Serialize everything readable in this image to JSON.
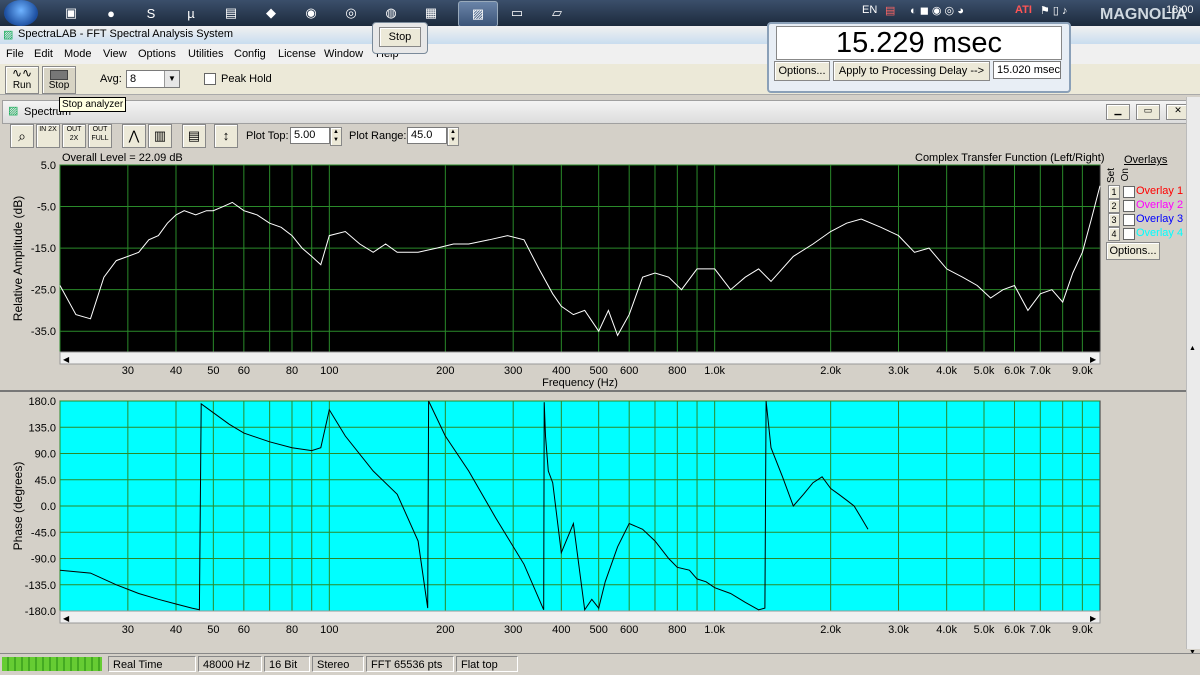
{
  "taskbar": {
    "lang": "EN",
    "clock": "18:00",
    "watermark": "MAGNOLIA",
    "tray_badge": "ATI"
  },
  "window": {
    "title": "SpectraLAB - FFT Spectral Analysis System"
  },
  "menu": [
    "File",
    "Edit",
    "Mode",
    "View",
    "Options",
    "Utilities",
    "Config",
    "License",
    "Window",
    "Help"
  ],
  "toolbar": {
    "run_label": "Run",
    "stop_label": "Stop",
    "avg_label": "Avg:",
    "avg_value": "8",
    "peak_hold_label": "Peak Hold",
    "tooltip": "Stop analyzer"
  },
  "stop_float": {
    "label": "Stop"
  },
  "delay": {
    "value": "15.229 msec",
    "options_label": "Options...",
    "apply_label": "Apply to Processing Delay -->",
    "processing_delay": "15.020 msec"
  },
  "spectrum": {
    "window_title": "Spectrum",
    "tool_labels": {
      "zoom_in_2x": "IN 2X",
      "zoom_out_2x": "OUT 2X",
      "zoom_out_full": "OUT FULL"
    },
    "plot_top_label": "Plot Top:",
    "plot_top_value": "5.00",
    "plot_range_label": "Plot Range:",
    "plot_range_value": "45.0",
    "overlays_header": "Overlays",
    "set_label": "Set",
    "on_label": "On",
    "overlays": [
      {
        "num": "1",
        "label": "Overlay 1",
        "color": "#ff0000"
      },
      {
        "num": "2",
        "label": "Overlay 2",
        "color": "#ff00ff"
      },
      {
        "num": "3",
        "label": "Overlay 3",
        "color": "#0000ff"
      },
      {
        "num": "4",
        "label": "Overlay 4",
        "color": "#00ffff"
      }
    ],
    "overlay_options_label": "Options..."
  },
  "chart_data": [
    {
      "type": "line",
      "title": "Complex Transfer Function (Left/Right)",
      "subtitle": "Overall Level = 22.09 dB",
      "xlabel": "Frequency (Hz)",
      "ylabel": "Relative Amplitude (dB)",
      "xscale": "log",
      "xlim": [
        20,
        10000
      ],
      "ylim": [
        -40,
        5
      ],
      "yticks": [
        "5.0",
        "-5.0",
        "-15.0",
        "-25.0",
        "-35.0"
      ],
      "xticks": [
        "30",
        "40",
        "50",
        "60",
        "80",
        "100",
        "200",
        "300",
        "400",
        "500",
        "600",
        "800",
        "1.0k",
        "2.0k",
        "3.0k",
        "4.0k",
        "5.0k",
        "6.0k",
        "7.0k",
        "9.0k"
      ],
      "background": "#000000",
      "grid_color": "#2a8a2a",
      "line_color": "#ffffff",
      "x": [
        20,
        22,
        24,
        26,
        28,
        30,
        32,
        34,
        36,
        38,
        40,
        42,
        45,
        48,
        50,
        53,
        56,
        60,
        65,
        70,
        75,
        80,
        85,
        90,
        95,
        100,
        110,
        120,
        130,
        140,
        150,
        170,
        190,
        210,
        230,
        260,
        290,
        320,
        350,
        380,
        400,
        430,
        460,
        500,
        530,
        560,
        600,
        650,
        700,
        760,
        820,
        900,
        1000,
        1100,
        1200,
        1300,
        1400,
        1600,
        1800,
        2000,
        2200,
        2400,
        2700,
        3000,
        3300,
        3600,
        4000,
        4400,
        4800,
        5200,
        5600,
        6000,
        6500,
        7000,
        7500,
        8000,
        8500,
        9000,
        9500,
        10000
      ],
      "y": [
        -24,
        -31,
        -32,
        -22,
        -18,
        -17,
        -16,
        -13,
        -12,
        -9,
        -7,
        -6,
        -7,
        -6,
        -6,
        -5,
        -4,
        -6,
        -7,
        -9,
        -10,
        -12,
        -15,
        -17,
        -19,
        -12,
        -11,
        -14,
        -16,
        -14,
        -16,
        -16,
        -15,
        -14,
        -14,
        -13,
        -12,
        -13,
        -20,
        -26,
        -29,
        -31,
        -30,
        -35,
        -30,
        -36,
        -31,
        -22,
        -21,
        -22,
        -25,
        -20,
        -20,
        -25,
        -22,
        -20,
        -23,
        -17,
        -14,
        -11,
        -9,
        -8,
        -10,
        -12,
        -16,
        -15,
        -20,
        -22,
        -24,
        -27,
        -25,
        -24,
        -30,
        -26,
        -25,
        -28,
        -21,
        -16,
        -8,
        0
      ]
    },
    {
      "type": "line",
      "xlabel": "",
      "ylabel": "Phase (degrees)",
      "xscale": "log",
      "xlim": [
        20,
        10000
      ],
      "ylim": [
        -180,
        180
      ],
      "yticks": [
        "180.0",
        "135.0",
        "90.0",
        "45.0",
        "0.0",
        "-45.0",
        "-90.0",
        "-135.0",
        "-180.0"
      ],
      "xticks": [
        "30",
        "40",
        "50",
        "60",
        "80",
        "100",
        "200",
        "300",
        "400",
        "500",
        "600",
        "800",
        "1.0k",
        "2.0k",
        "3.0k",
        "4.0k",
        "5.0k",
        "6.0k",
        "7.0k",
        "9.0k"
      ],
      "background": "#00ffff",
      "grid_color": "#2a8a2a",
      "line_color": "#000000",
      "x": [
        20,
        24,
        28,
        32,
        36,
        40,
        44,
        46,
        46.5,
        50,
        55,
        60,
        70,
        80,
        90,
        95,
        100,
        110,
        130,
        150,
        170,
        180,
        181,
        200,
        230,
        270,
        320,
        360,
        361,
        364,
        370,
        380,
        400,
        430,
        460,
        480,
        500,
        520,
        560,
        600,
        650,
        700,
        760,
        800,
        860,
        900,
        950,
        1000,
        1100,
        1200,
        1300,
        1350,
        1360,
        1400,
        1500,
        1600,
        1700,
        1800,
        1900,
        2000,
        2100,
        2200,
        2300,
        2400,
        2500
      ],
      "y": [
        -110,
        -115,
        -135,
        -150,
        -160,
        -168,
        -175,
        -178,
        175,
        160,
        140,
        125,
        110,
        100,
        95,
        100,
        165,
        120,
        60,
        20,
        -60,
        -175,
        180,
        120,
        60,
        -20,
        -100,
        -178,
        178,
        120,
        60,
        40,
        -80,
        -30,
        -178,
        -160,
        -175,
        -130,
        -70,
        -30,
        -40,
        -60,
        -90,
        -105,
        -110,
        -125,
        -130,
        -140,
        -150,
        -165,
        -178,
        -175,
        180,
        100,
        50,
        0,
        20,
        40,
        50,
        30,
        20,
        10,
        0,
        -20,
        -40
      ]
    }
  ],
  "status": {
    "realtime": "Real Time",
    "rate": "48000 Hz",
    "bits": "16 Bit",
    "channels": "Stereo",
    "fft": "FFT 65536 pts",
    "window": "Flat top"
  }
}
